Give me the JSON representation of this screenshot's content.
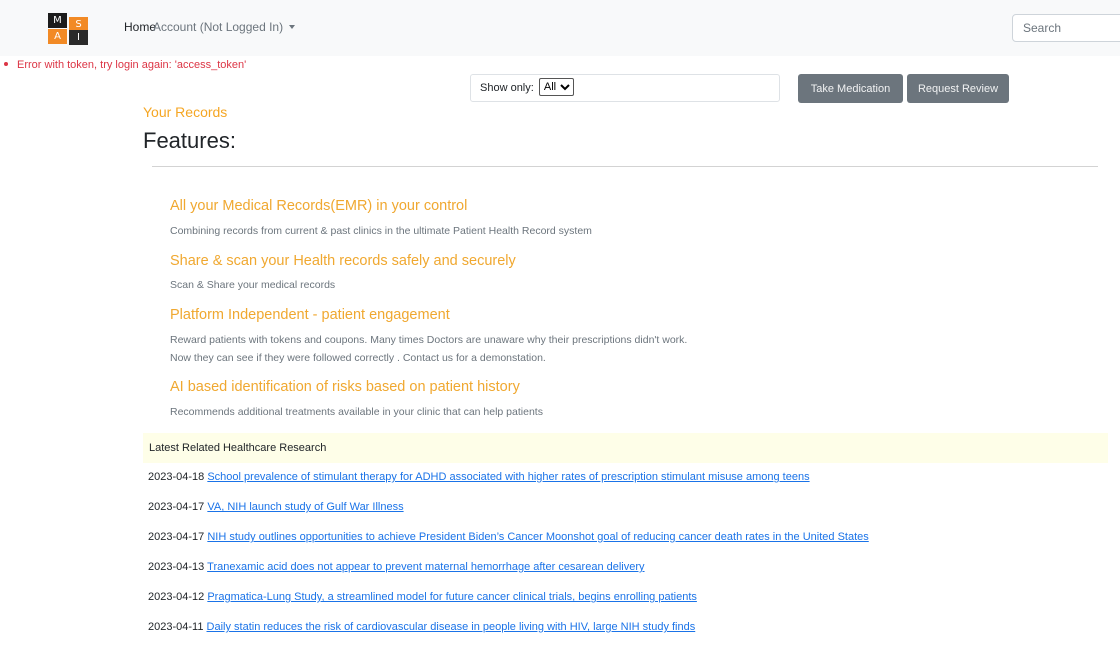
{
  "navbar": {
    "logo_letters": [
      "M",
      "S",
      "A",
      "I"
    ],
    "home_label": "Home",
    "account_label": "Account (Not Logged In)",
    "search_placeholder": "Search"
  },
  "error": {
    "message": "Error with token, try login again: 'access_token'"
  },
  "toolbar": {
    "filter_label": "Show only:",
    "filter_selected": "All",
    "take_medication_label": "Take Medication",
    "request_review_label": "Request Review"
  },
  "main": {
    "records_link": "Your Records",
    "features_title": "Features:",
    "features": [
      {
        "title": "All your Medical Records(EMR) in your control",
        "desc": [
          "Combining records from current & past clinics in the ultimate Patient Health Record system"
        ]
      },
      {
        "title": "Share & scan your Health records safely and securely",
        "desc": [
          "Scan & Share your medical records"
        ]
      },
      {
        "title": "Platform Independent - patient engagement",
        "desc": [
          "Reward patients with tokens and coupons. Many times Doctors are unaware why their prescriptions didn't work.",
          "Now they can see if they were followed correctly . Contact us for a demonstation."
        ]
      },
      {
        "title": "AI based identification of risks based on patient history",
        "desc": [
          "Recommends additional treatments available in your clinic that can help patients"
        ]
      }
    ]
  },
  "research": {
    "header": "Latest Related Healthcare Research",
    "items": [
      {
        "date": "2023-04-18",
        "title": "School prevalence of stimulant therapy for ADHD associated with higher rates of prescription stimulant misuse among teens"
      },
      {
        "date": "2023-04-17",
        "title": "VA, NIH launch study of Gulf War Illness"
      },
      {
        "date": "2023-04-17",
        "title": "NIH study outlines opportunities to achieve President Biden’s Cancer Moonshot goal of reducing cancer death rates in the United States"
      },
      {
        "date": "2023-04-13",
        "title": "Tranexamic acid does not appear to prevent maternal hemorrhage after cesarean delivery"
      },
      {
        "date": "2023-04-12",
        "title": "Pragmatica-Lung Study, a streamlined model for future cancer clinical trials, begins enrolling patients"
      },
      {
        "date": "2023-04-11",
        "title": "Daily statin reduces the risk of cardiovascular disease in people living with HIV, large NIH study finds"
      }
    ]
  },
  "colors": {
    "accent_orange": "#f0a830",
    "error_red": "#dc3545",
    "link_blue": "#1a73e8",
    "button_gray": "#6c757d"
  }
}
